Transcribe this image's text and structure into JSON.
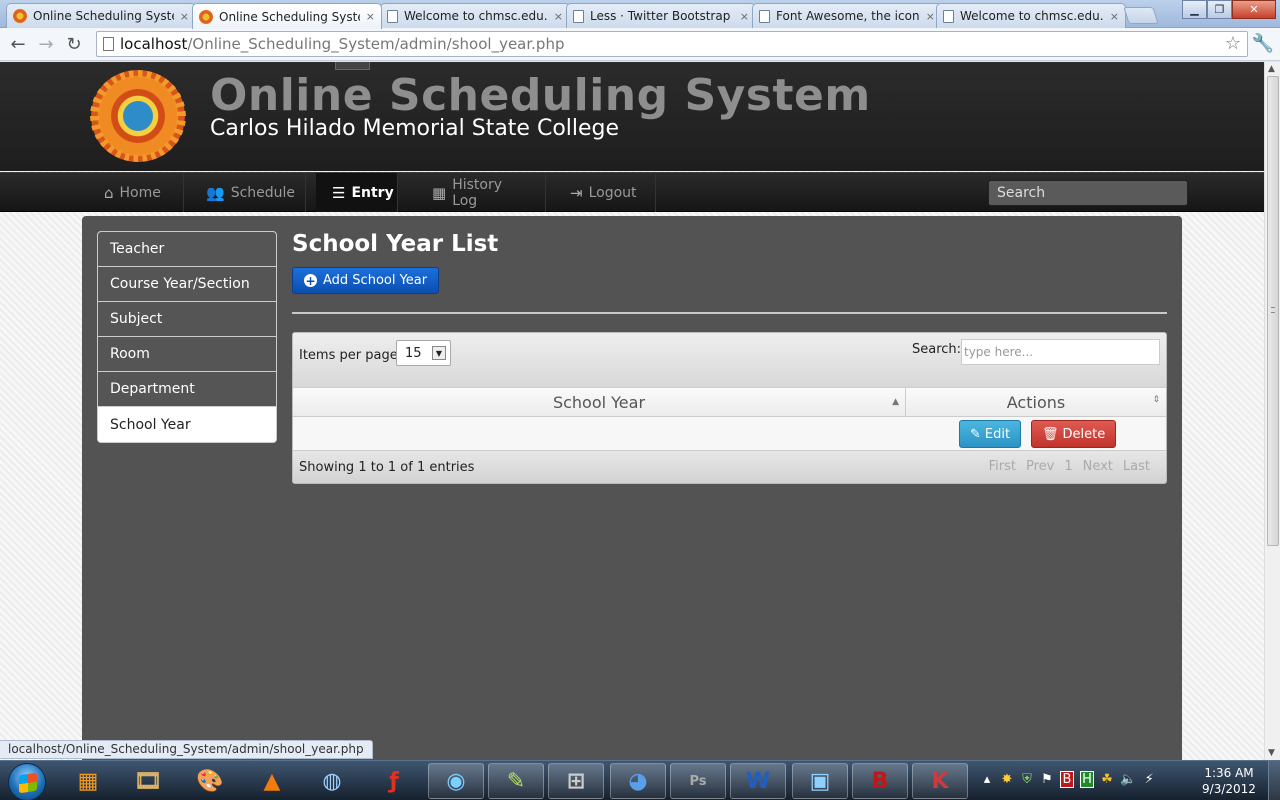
{
  "browser": {
    "tabs": [
      {
        "title": "Online Scheduling Syster",
        "icon": "seal"
      },
      {
        "title": "Online Scheduling Syster",
        "icon": "seal"
      },
      {
        "title": "Welcome to chmsc.edu.p",
        "icon": "page"
      },
      {
        "title": "Less · Twitter Bootstrap",
        "icon": "page"
      },
      {
        "title": "Font Awesome, the iconic",
        "icon": "page"
      },
      {
        "title": "Welcome to chmsc.edu.p",
        "icon": "page"
      }
    ],
    "close_glyph": "×",
    "url_host": "localhost",
    "url_path": "/Online_Scheduling_System/admin/shool_year.php",
    "status_url": "localhost/Online_Scheduling_System/admin/shool_year.php"
  },
  "header": {
    "title": "Online Scheduling System",
    "subtitle": "Carlos Hilado Memorial State College"
  },
  "nav": {
    "items": [
      {
        "label": "Home",
        "icon": "home-icon",
        "glyph": "⌂"
      },
      {
        "label": "Schedule",
        "icon": "group-icon",
        "glyph": "👥"
      },
      {
        "label": "Entry",
        "icon": "list-icon",
        "glyph": "☰"
      },
      {
        "label": "History Log",
        "icon": "table-icon",
        "glyph": "▦"
      },
      {
        "label": "Logout",
        "icon": "signout-icon",
        "glyph": "⇥"
      }
    ],
    "search_placeholder": "Search"
  },
  "sidebar": {
    "items": [
      {
        "label": "Teacher"
      },
      {
        "label": "Course Year/Section"
      },
      {
        "label": "Subject"
      },
      {
        "label": "Room"
      },
      {
        "label": "Department"
      },
      {
        "label": "School Year"
      }
    ]
  },
  "content": {
    "heading": "School Year List",
    "add_button": "Add School Year",
    "items_per_page_label": "Items per page:",
    "items_per_page_value": "15",
    "search_label": "Search:",
    "search_placeholder": "type here...",
    "columns": [
      "School Year",
      "Actions"
    ],
    "row": {
      "school_year": "",
      "edit": "Edit",
      "delete": "Delete"
    },
    "showing": "Showing 1 to 1 of 1 entries",
    "pager": [
      "First",
      "Prev",
      "1",
      "Next",
      "Last"
    ]
  },
  "taskbar": {
    "clock_time": "1:36 AM",
    "clock_date": "9/3/2012"
  },
  "colors": {
    "add_button": "#0b4fb0",
    "edit_button": "#2b93c3",
    "delete_button": "#c0342c",
    "panel": "#535353"
  }
}
